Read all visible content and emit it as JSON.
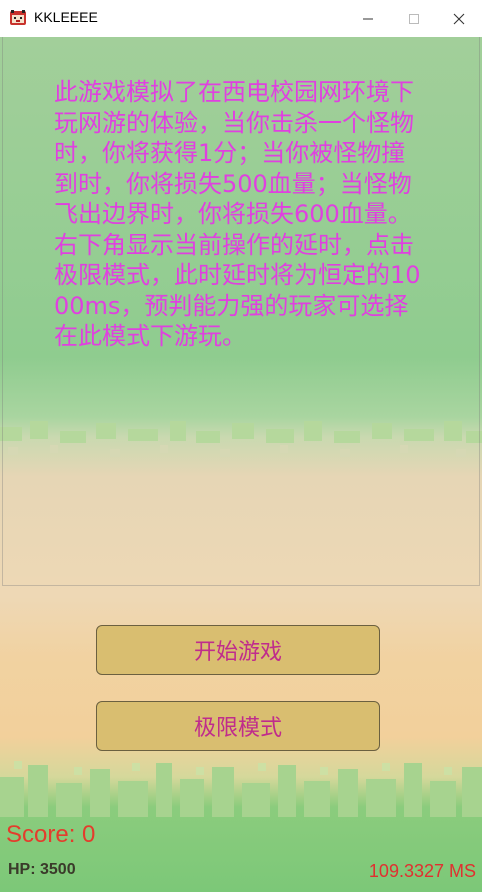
{
  "window": {
    "title": "KKLEEEE",
    "app_icon": "game-face-icon",
    "controls": [
      "minimize-icon",
      "maximize-icon",
      "close-icon"
    ]
  },
  "intro_text": "此游戏模拟了在西电校园网环境下玩网游的体验，当你击杀一个怪物时，你将获得1分；当你被怪物撞到时，你将损失500血量；当怪物飞出边界时，你将损失600血量。右下角显示当前操作的延时，点击极限模式，此时延时将为恒定的1000ms，预判能力强的玩家可选择在此模式下游玩。",
  "buttons": {
    "start": "开始游戏",
    "extreme": "极限模式"
  },
  "hud": {
    "score": "Score: 0",
    "hp": "HP: 3500",
    "latency": "109.3327 MS"
  },
  "colors": {
    "intro_text": "#e040e0",
    "button_bg": "#d9be70",
    "button_text": "#c02c8c",
    "score": "#e43c2c",
    "latency": "#e03030"
  }
}
